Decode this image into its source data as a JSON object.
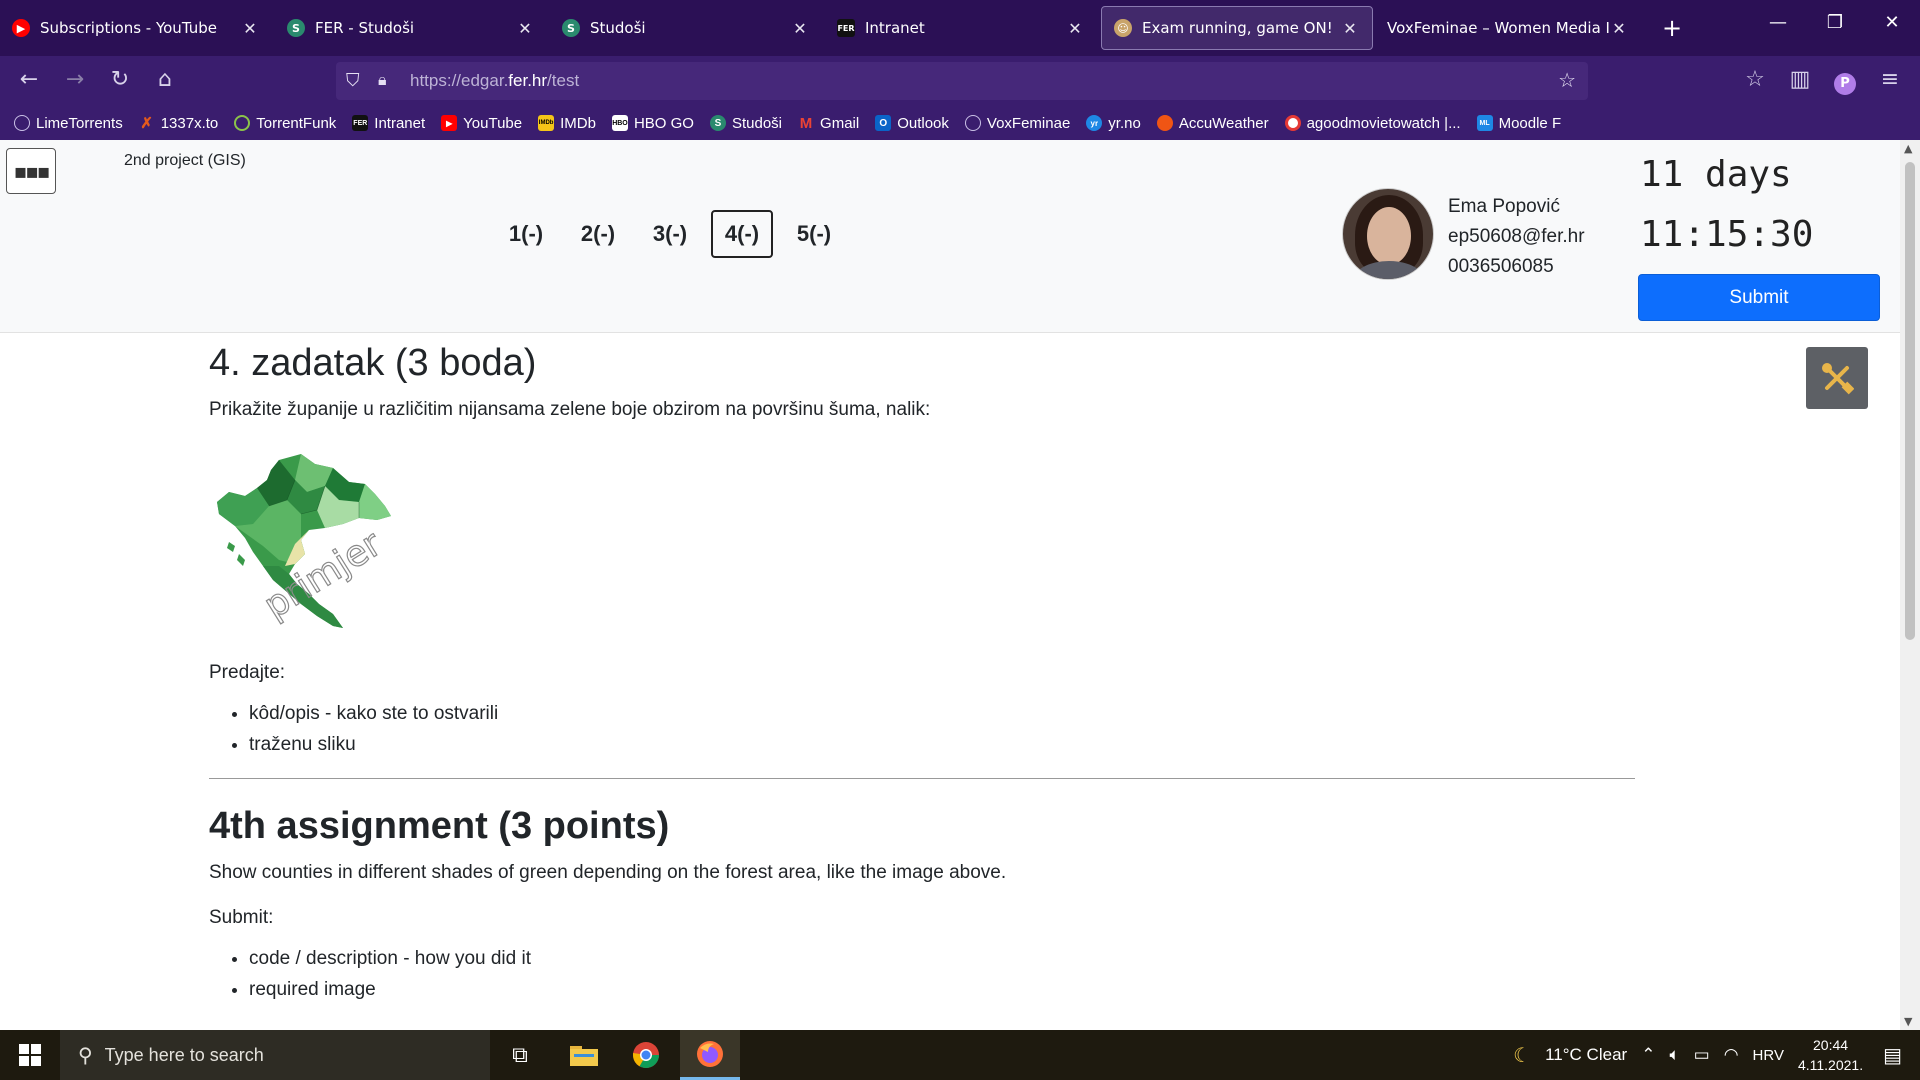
{
  "browser": {
    "tabs": [
      {
        "label": "Subscriptions - YouTube",
        "icon": "youtube-icon",
        "color": "#ff0000"
      },
      {
        "label": "FER - Studoši",
        "icon": "studosi-icon",
        "color": "#2a8a6e"
      },
      {
        "label": "Studoši",
        "icon": "studosi-icon",
        "color": "#2a8a6e"
      },
      {
        "label": "Intranet",
        "icon": "fer-icon",
        "color": "#111111"
      },
      {
        "label": "Exam running, game ON!",
        "icon": "edgar-icon",
        "color": "#c9a46a"
      },
      {
        "label": "VoxFeminae – Women Media Inde",
        "icon": "globe-icon",
        "color": "#2b1055"
      }
    ],
    "active_tab_index": 4,
    "url_prefix": "https://edgar.",
    "url_domain": "fer.hr",
    "url_suffix": "/test",
    "bookmarks": [
      {
        "label": "LimeTorrents",
        "icon": "globe-icon",
        "color": "#7d6fb0"
      },
      {
        "label": "1337x.to",
        "icon": "x-icon",
        "color": "#e45a1c"
      },
      {
        "label": "TorrentFunk",
        "icon": "torrentfunk-icon",
        "color": "#8bc34a"
      },
      {
        "label": "Intranet",
        "icon": "fer-icon",
        "color": "#111111"
      },
      {
        "label": "YouTube",
        "icon": "youtube-icon",
        "color": "#ff0000"
      },
      {
        "label": "IMDb",
        "icon": "imdb-icon",
        "color": "#f5c518"
      },
      {
        "label": "HBO GO",
        "icon": "hbo-icon",
        "color": "#222222"
      },
      {
        "label": "Studoši",
        "icon": "studosi-icon",
        "color": "#2a8a6e"
      },
      {
        "label": "Gmail",
        "icon": "gmail-icon",
        "color": "#ea4335"
      },
      {
        "label": "Outlook",
        "icon": "outlook-icon",
        "color": "#0a64c8"
      },
      {
        "label": "VoxFeminae",
        "icon": "globe-icon",
        "color": "#7d6fb0"
      },
      {
        "label": "yr.no",
        "icon": "yr-icon",
        "color": "#1e88e5"
      },
      {
        "label": "AccuWeather",
        "icon": "accuweather-icon",
        "color": "#f05514"
      },
      {
        "label": "agoodmovietowatch |...",
        "icon": "movie-icon",
        "color": "#e53935"
      },
      {
        "label": "Moodle F",
        "icon": "moodle-icon",
        "color": "#1e88e5"
      }
    ]
  },
  "exam": {
    "project_title": "2nd project (GIS)",
    "questions": [
      "1(-)",
      "2(-)",
      "3(-)",
      "4(-)",
      "5(-)"
    ],
    "active_question_index": 3,
    "user": {
      "name": "Ema Popović",
      "email": "ep50608@fer.hr",
      "jmbag": "0036506085"
    },
    "timer_days": "11 days",
    "timer_clock": "11:15:30",
    "submit_label": "Submit"
  },
  "content": {
    "hr": {
      "title": "4. zadatak (3 boda)",
      "description": "Prikažite županije u različitim nijansama zelene boje obzirom na površinu šuma, nalik:",
      "image_watermark": "primjer",
      "submit_label": "Predajte:",
      "items": [
        "kôd/opis - kako ste to ostvarili",
        "traženu sliku"
      ]
    },
    "en": {
      "title": "4th assignment (3 points)",
      "description": "Show counties in different shades of green depending on the forest area, like the image above.",
      "submit_label": "Submit:",
      "items": [
        "code / description - how you did it",
        "required image"
      ]
    }
  },
  "taskbar": {
    "search_placeholder": "Type here to search",
    "weather": "11°C  Clear",
    "language": "HRV",
    "time": "20:44",
    "date": "4.11.2021."
  },
  "colors": {
    "tabbar_bg": "#2b1055",
    "navbar_bg": "#3a1d6e",
    "submit_blue": "#0d6efd",
    "tools_gray": "#5d6065",
    "tools_icon": "#e8b54a"
  }
}
